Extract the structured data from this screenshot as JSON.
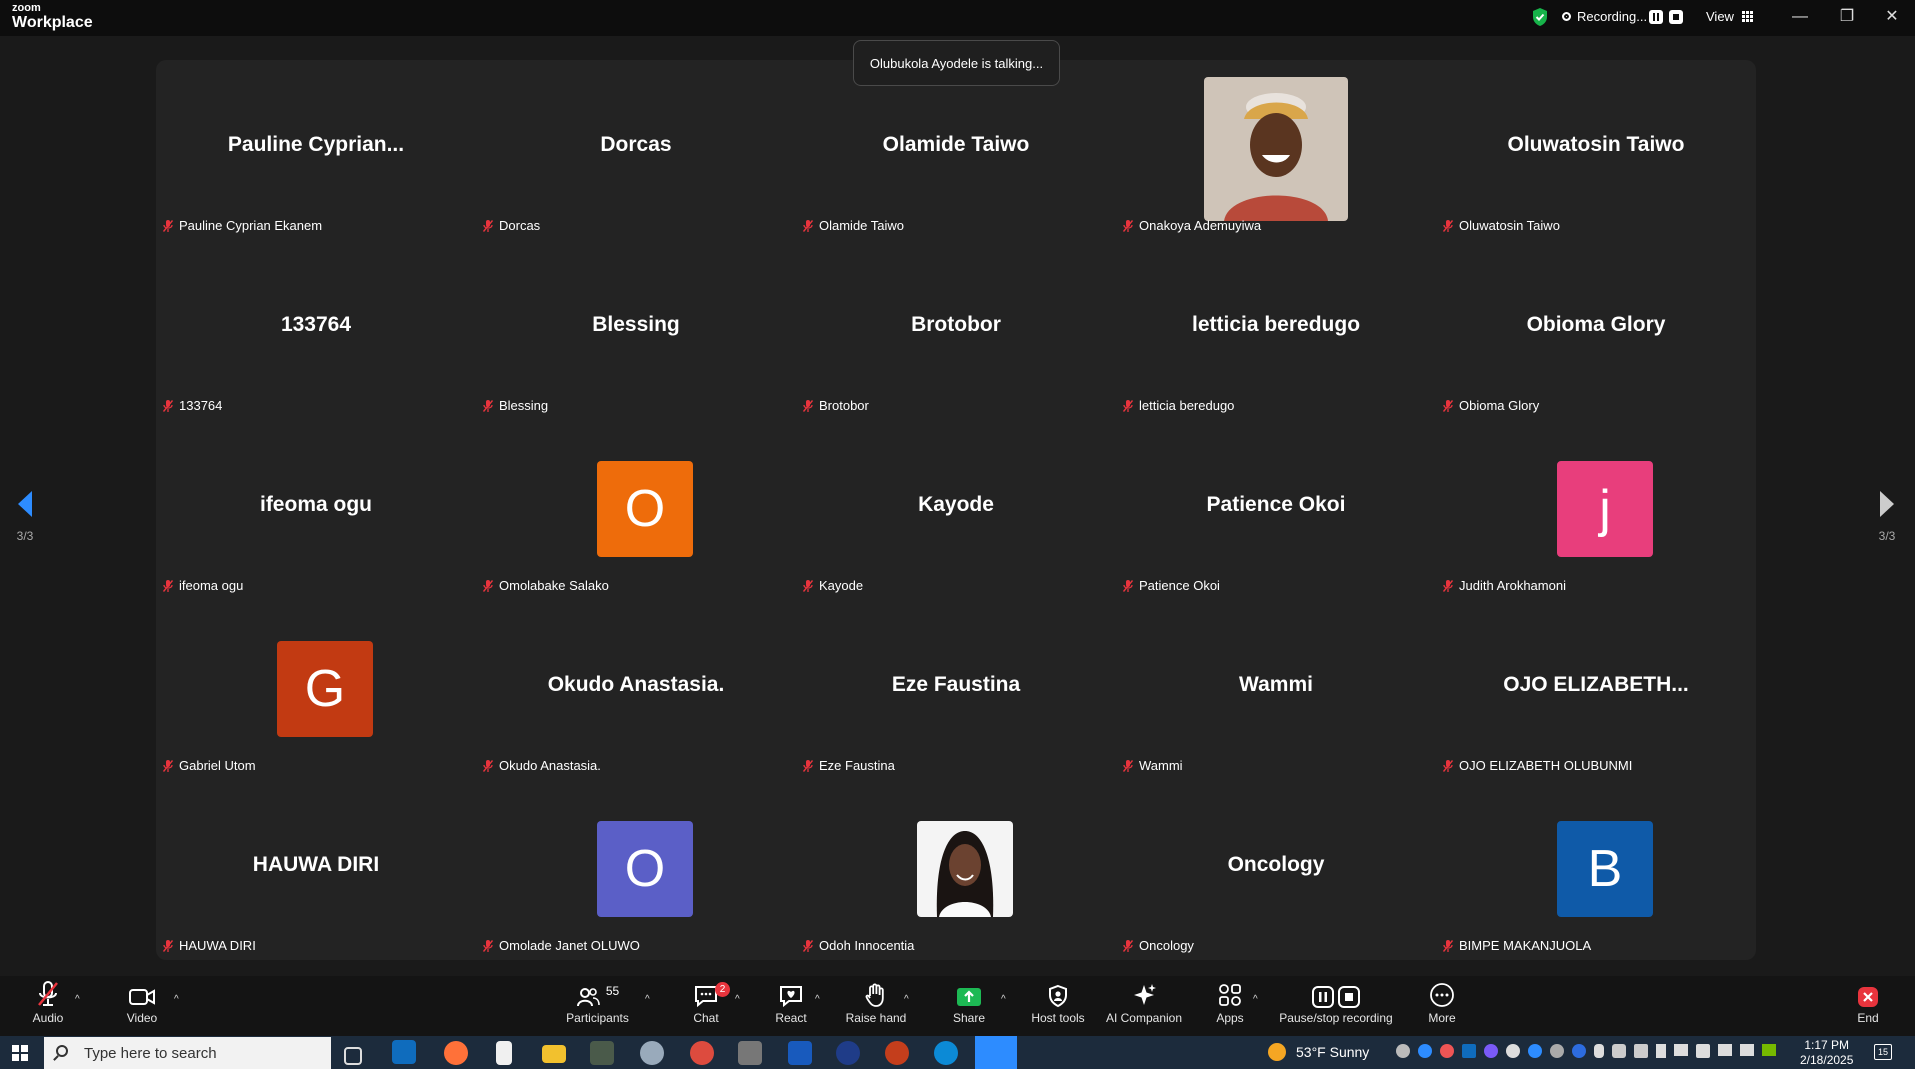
{
  "app": {
    "logo_top": "zoom",
    "logo_bottom": "Workplace"
  },
  "titlebar": {
    "recording_label": "Recording...",
    "view_label": "View",
    "minimize": "—",
    "restore": "❐",
    "close": "✕"
  },
  "talking_banner": "Olubukola Ayodele is talking...",
  "pagination": {
    "left": "3/3",
    "right": "3/3"
  },
  "participants": [
    {
      "display": "Pauline  Cyprian...",
      "name": "Pauline Cyprian Ekanem"
    },
    {
      "display": "Dorcas",
      "name": "Dorcas"
    },
    {
      "display": "Olamide Taiwo",
      "name": "Olamide Taiwo"
    },
    {
      "display": "",
      "name": "Onakoya Ademuyiwa",
      "photo": "man-smiling-photo"
    },
    {
      "display": "Oluwatosin Taiwo",
      "name": "Oluwatosin Taiwo"
    },
    {
      "display": "133764",
      "name": "133764"
    },
    {
      "display": "Blessing",
      "name": "Blessing"
    },
    {
      "display": "Brotobor",
      "name": "Brotobor"
    },
    {
      "display": "letticia beredugo",
      "name": "letticia beredugo"
    },
    {
      "display": "Obioma Glory",
      "name": "Obioma Glory"
    },
    {
      "display": "ifeoma ogu",
      "name": "ifeoma ogu"
    },
    {
      "display": "",
      "name": "Omolabake Salako",
      "avatar": "O",
      "color": "#ee6c0b"
    },
    {
      "display": "Kayode",
      "name": "Kayode"
    },
    {
      "display": "Patience Okoi",
      "name": "Patience Okoi"
    },
    {
      "display": "",
      "name": "Judith Arokhamoni",
      "avatar": "j",
      "color": "#e83e7c"
    },
    {
      "display": "",
      "name": "Gabriel Utom",
      "avatar": "G",
      "color": "#c23a12"
    },
    {
      "display": "Okudo Anastasia.",
      "name": "Okudo Anastasia."
    },
    {
      "display": "Eze Faustina",
      "name": "Eze Faustina"
    },
    {
      "display": "Wammi",
      "name": "Wammi"
    },
    {
      "display": "OJO  ELIZABETH...",
      "name": "OJO ELIZABETH OLUBUNMI"
    },
    {
      "display": "HAUWA DIRI",
      "name": "HAUWA DIRI"
    },
    {
      "display": "",
      "name": "Omolade Janet OLUWO",
      "avatar": "O",
      "color": "#5b5fc7"
    },
    {
      "display": "",
      "name": "Odoh Innocentia",
      "photo": "woman-portrait-photo"
    },
    {
      "display": "Oncology",
      "name": "Oncology"
    },
    {
      "display": "",
      "name": "BIMPE MAKANJUOLA",
      "avatar": "B",
      "color": "#0f5aa8"
    }
  ],
  "toolbar": {
    "audio": "Audio",
    "video": "Video",
    "participants": "Participants",
    "participants_count": "55",
    "chat": "Chat",
    "chat_badge": "2",
    "react": "React",
    "raise_hand": "Raise hand",
    "share": "Share",
    "host_tools": "Host tools",
    "ai_companion": "AI Companion",
    "apps": "Apps",
    "pause_stop": "Pause/stop recording",
    "more": "More",
    "end": "End"
  },
  "taskbar": {
    "search_placeholder": "Type here to search",
    "weather": "53°F  Sunny",
    "time": "1:17 PM",
    "date": "2/18/2025",
    "notifications": "15"
  },
  "colors": {
    "accent_green": "#17b34a",
    "end_red": "#e8343d",
    "share_green": "#1db954"
  }
}
